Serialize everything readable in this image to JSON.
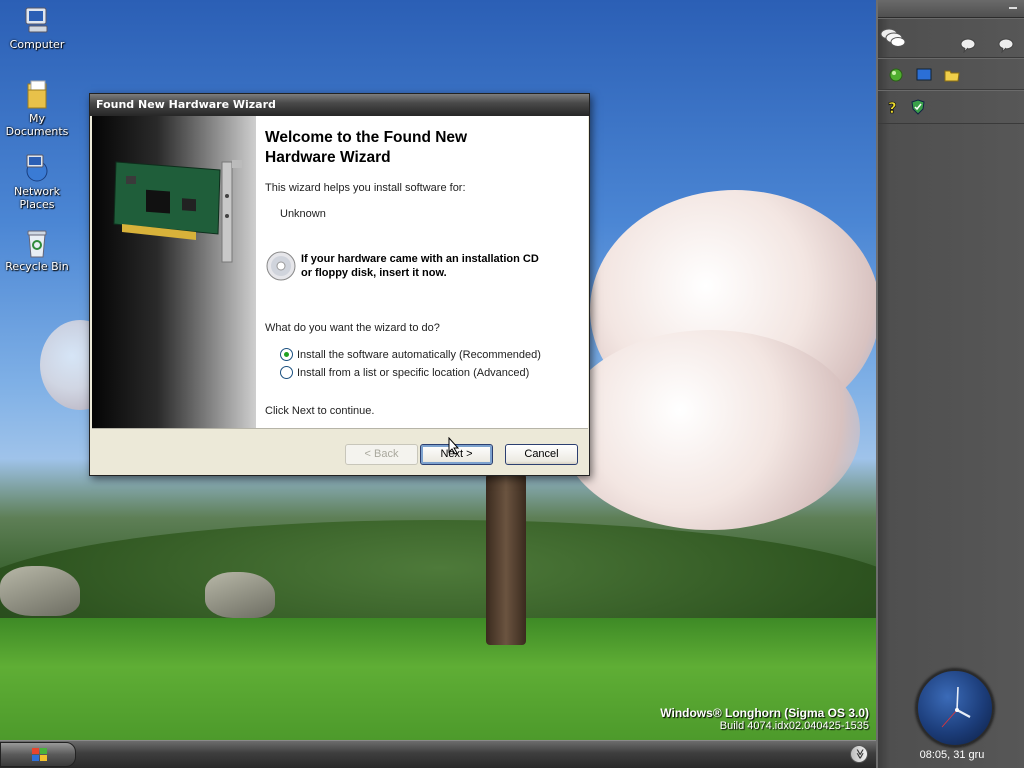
{
  "desktop": {
    "icons": [
      {
        "label": "Computer"
      },
      {
        "label": "My Documents"
      },
      {
        "label": "Network Places"
      },
      {
        "label": "Recycle Bin"
      }
    ],
    "watermark": {
      "line1": "Windows® Longhorn (Sigma OS 3.0)",
      "line2": "Build 4074.idx02.040425-1535"
    }
  },
  "wizard": {
    "title": "Found New Hardware Wizard",
    "heading_line1": "Welcome to the Found New",
    "heading_line2": "Hardware Wizard",
    "intro": "This wizard helps you install software for:",
    "device": "Unknown",
    "cd_hint_line1": "If your hardware came with an installation CD",
    "cd_hint_line2": "or floppy disk, insert it now.",
    "question": "What do you want the wizard to do?",
    "options": [
      {
        "label": "Install the software automatically (Recommended)",
        "selected": true
      },
      {
        "label": "Install from a list or specific location (Advanced)",
        "selected": false
      }
    ],
    "continue_text": "Click Next to continue.",
    "buttons": {
      "back": "< Back",
      "next": "Next >",
      "cancel": "Cancel"
    }
  },
  "sidebar": {
    "clock_text": "08:05, 31 gru"
  },
  "taskbar": {
    "start_icon": "windows-flag-icon",
    "overflow_icon": "chevron-double-down-icon"
  },
  "colors": {
    "wizard_title_bar": "#262626",
    "sidebar_bg": "#575757",
    "radio_selected": "#21a121",
    "button_border": "#2c3f70"
  }
}
